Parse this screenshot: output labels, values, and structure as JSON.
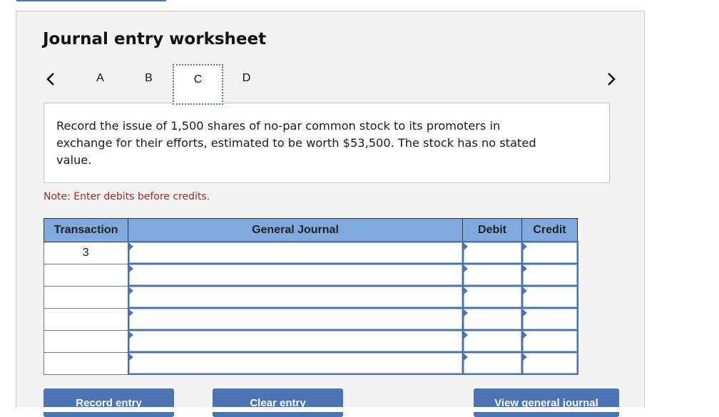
{
  "worksheet": {
    "title": "Journal entry worksheet",
    "nav": {
      "prev_icon": "chevron-left-icon",
      "next_icon": "chevron-right-icon",
      "tabs": [
        {
          "label": "A",
          "active": false
        },
        {
          "label": "B",
          "active": false
        },
        {
          "label": "C",
          "active": true
        },
        {
          "label": "D",
          "active": false
        }
      ]
    },
    "question": "Record the issue of 1,500 shares of no-par common stock to its promoters in exchange for their efforts, estimated to be worth $53,500. The stock has no stated value.",
    "note": "Note: Enter debits before credits.",
    "table": {
      "headers": [
        "Transaction",
        "General Journal",
        "Debit",
        "Credit"
      ],
      "rows": [
        {
          "transaction": "3",
          "general_journal": "",
          "debit": "",
          "credit": ""
        },
        {
          "transaction": "",
          "general_journal": "",
          "debit": "",
          "credit": ""
        },
        {
          "transaction": "",
          "general_journal": "",
          "debit": "",
          "credit": ""
        },
        {
          "transaction": "",
          "general_journal": "",
          "debit": "",
          "credit": ""
        },
        {
          "transaction": "",
          "general_journal": "",
          "debit": "",
          "credit": ""
        },
        {
          "transaction": "",
          "general_journal": "",
          "debit": "",
          "credit": ""
        }
      ]
    },
    "buttons": {
      "record": "Record entry",
      "clear": "Clear entry",
      "view": "View general journal"
    }
  },
  "colors": {
    "accent": "#4a74b3",
    "header_bg": "#80a9de",
    "note": "#a52a2a",
    "panel_bg": "#f2f2f2"
  }
}
